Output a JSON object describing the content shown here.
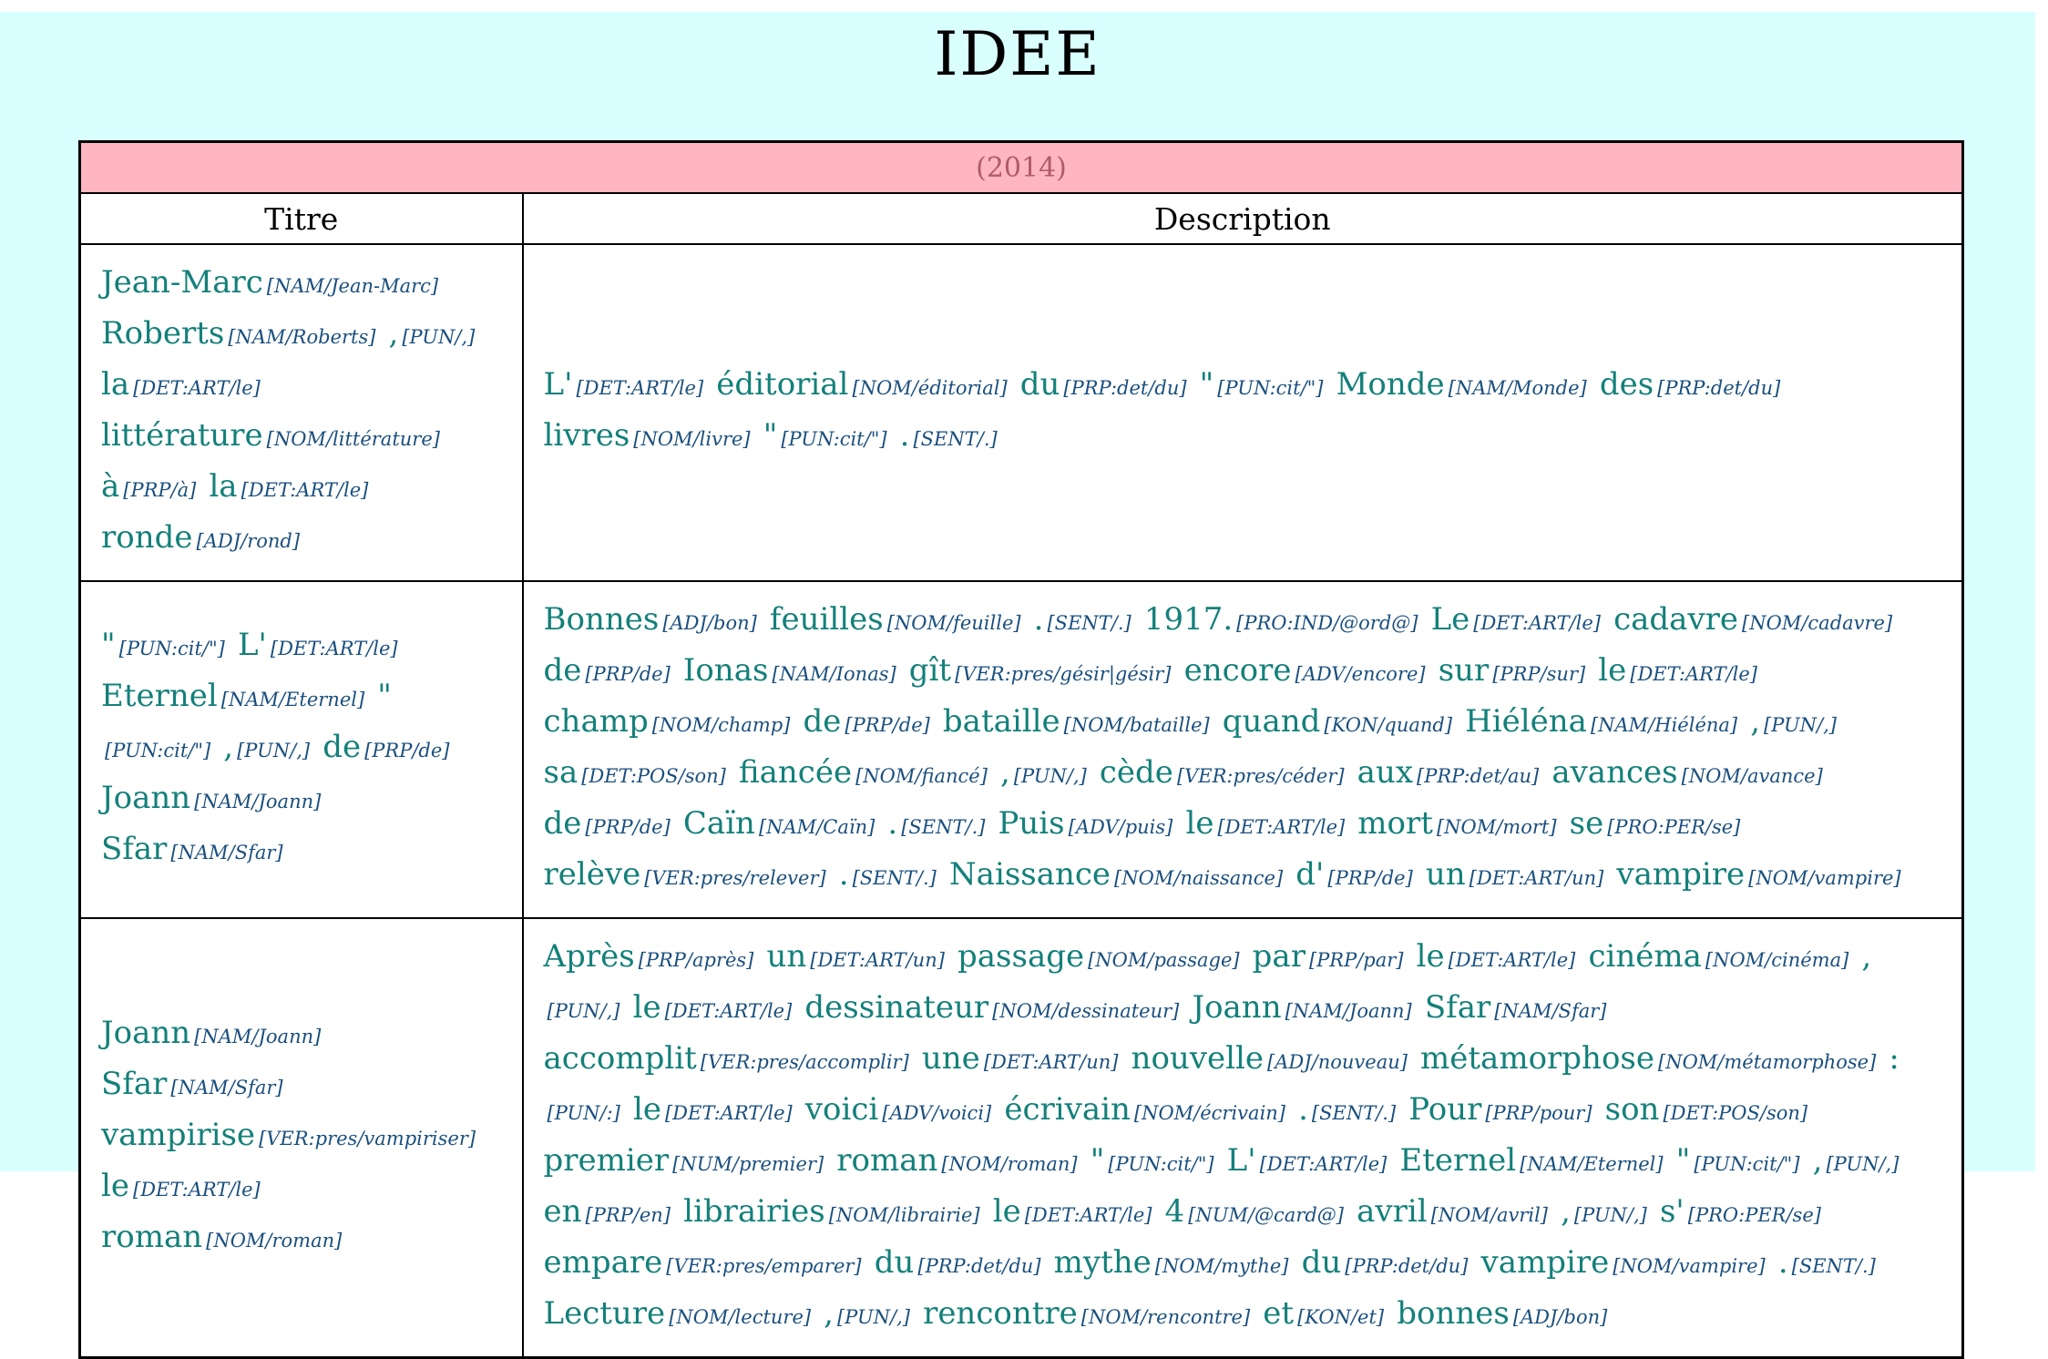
{
  "page": {
    "title": "IDEE"
  },
  "table": {
    "year": "(2014)",
    "headers": {
      "title": "Titre",
      "description": "Description"
    },
    "rows": [
      {
        "title": [
          {
            "w": "Jean-Marc",
            "t": "[NAM/Jean-Marc]"
          },
          {
            "w": "Roberts",
            "t": "[NAM/Roberts]"
          },
          {
            "w": ",",
            "t": "[PUN/,]"
          },
          {
            "w": "la",
            "t": "[DET:ART/le]"
          },
          {
            "w": "littérature",
            "t": "[NOM/littérature]"
          },
          {
            "w": "à",
            "t": "[PRP/à]"
          },
          {
            "w": "la",
            "t": "[DET:ART/le]"
          },
          {
            "w": "ronde",
            "t": "[ADJ/rond]"
          }
        ],
        "description": [
          {
            "w": "L'",
            "t": "[DET:ART/le]"
          },
          {
            "w": "éditorial",
            "t": "[NOM/éditorial]"
          },
          {
            "w": "du",
            "t": "[PRP:det/du]"
          },
          {
            "w": "\"",
            "t": "[PUN:cit/\"]"
          },
          {
            "w": "Monde",
            "t": "[NAM/Monde]"
          },
          {
            "w": "des",
            "t": "[PRP:det/du]"
          },
          {
            "w": "livres",
            "t": "[NOM/livre]"
          },
          {
            "w": "\"",
            "t": "[PUN:cit/\"]"
          },
          {
            "w": ".",
            "t": "[SENT/.]"
          }
        ]
      },
      {
        "title": [
          {
            "w": "\"",
            "t": "[PUN:cit/\"]"
          },
          {
            "w": "L'",
            "t": "[DET:ART/le]"
          },
          {
            "w": "Eternel",
            "t": "[NAM/Eternel]"
          },
          {
            "w": "\"",
            "t": "[PUN:cit/\"]"
          },
          {
            "w": ",",
            "t": "[PUN/,]"
          },
          {
            "w": "de",
            "t": "[PRP/de]"
          },
          {
            "w": "Joann",
            "t": "[NAM/Joann]"
          },
          {
            "w": "Sfar",
            "t": "[NAM/Sfar]"
          }
        ],
        "description": [
          {
            "w": "Bonnes",
            "t": "[ADJ/bon]"
          },
          {
            "w": "feuilles",
            "t": "[NOM/feuille]"
          },
          {
            "w": ".",
            "t": "[SENT/.]"
          },
          {
            "w": "1917.",
            "t": "[PRO:IND/@ord@]"
          },
          {
            "w": "Le",
            "t": "[DET:ART/le]"
          },
          {
            "w": "cadavre",
            "t": "[NOM/cadavre]"
          },
          {
            "w": "de",
            "t": "[PRP/de]"
          },
          {
            "w": "Ionas",
            "t": "[NAM/Ionas]"
          },
          {
            "w": "gît",
            "t": "[VER:pres/gésir|gésir]"
          },
          {
            "w": "encore",
            "t": "[ADV/encore]"
          },
          {
            "w": "sur",
            "t": "[PRP/sur]"
          },
          {
            "w": "le",
            "t": "[DET:ART/le]"
          },
          {
            "w": "champ",
            "t": "[NOM/champ]"
          },
          {
            "w": "de",
            "t": "[PRP/de]"
          },
          {
            "w": "bataille",
            "t": "[NOM/bataille]"
          },
          {
            "w": "quand",
            "t": "[KON/quand]"
          },
          {
            "w": "Hiéléna",
            "t": "[NAM/Hiéléna]"
          },
          {
            "w": ",",
            "t": "[PUN/,]"
          },
          {
            "w": "sa",
            "t": "[DET:POS/son]"
          },
          {
            "w": "fiancée",
            "t": "[NOM/fiancé]"
          },
          {
            "w": ",",
            "t": "[PUN/,]"
          },
          {
            "w": "cède",
            "t": "[VER:pres/céder]"
          },
          {
            "w": "aux",
            "t": "[PRP:det/au]"
          },
          {
            "w": "avances",
            "t": "[NOM/avance]"
          },
          {
            "w": "de",
            "t": "[PRP/de]"
          },
          {
            "w": "Caïn",
            "t": "[NAM/Caïn]"
          },
          {
            "w": ".",
            "t": "[SENT/.]"
          },
          {
            "w": "Puis",
            "t": "[ADV/puis]"
          },
          {
            "w": "le",
            "t": "[DET:ART/le]"
          },
          {
            "w": "mort",
            "t": "[NOM/mort]"
          },
          {
            "w": "se",
            "t": "[PRO:PER/se]"
          },
          {
            "w": "relève",
            "t": "[VER:pres/relever]"
          },
          {
            "w": ".",
            "t": "[SENT/.]"
          },
          {
            "w": "Naissance",
            "t": "[NOM/naissance]"
          },
          {
            "w": "d'",
            "t": "[PRP/de]"
          },
          {
            "w": "un",
            "t": "[DET:ART/un]"
          },
          {
            "w": "vampire",
            "t": "[NOM/vampire]"
          }
        ]
      },
      {
        "title": [
          {
            "w": "Joann",
            "t": "[NAM/Joann]"
          },
          {
            "w": "Sfar",
            "t": "[NAM/Sfar]"
          },
          {
            "w": "vampirise",
            "t": "[VER:pres/vampiriser]"
          },
          {
            "w": "le",
            "t": "[DET:ART/le]"
          },
          {
            "w": "roman",
            "t": "[NOM/roman]"
          }
        ],
        "description": [
          {
            "w": "Après",
            "t": "[PRP/après]"
          },
          {
            "w": "un",
            "t": "[DET:ART/un]"
          },
          {
            "w": "passage",
            "t": "[NOM/passage]"
          },
          {
            "w": "par",
            "t": "[PRP/par]"
          },
          {
            "w": "le",
            "t": "[DET:ART/le]"
          },
          {
            "w": "cinéma",
            "t": "[NOM/cinéma]"
          },
          {
            "w": ",",
            "t": "[PUN/,]"
          },
          {
            "w": "le",
            "t": "[DET:ART/le]"
          },
          {
            "w": "dessinateur",
            "t": "[NOM/dessinateur]"
          },
          {
            "w": "Joann",
            "t": "[NAM/Joann]"
          },
          {
            "w": "Sfar",
            "t": "[NAM/Sfar]"
          },
          {
            "w": "accomplit",
            "t": "[VER:pres/accomplir]"
          },
          {
            "w": "une",
            "t": "[DET:ART/un]"
          },
          {
            "w": "nouvelle",
            "t": "[ADJ/nouveau]"
          },
          {
            "w": "métamorphose",
            "t": "[NOM/métamorphose]"
          },
          {
            "w": ":",
            "t": "[PUN/:]"
          },
          {
            "w": "le",
            "t": "[DET:ART/le]"
          },
          {
            "w": "voici",
            "t": "[ADV/voici]"
          },
          {
            "w": "écrivain",
            "t": "[NOM/écrivain]"
          },
          {
            "w": ".",
            "t": "[SENT/.]"
          },
          {
            "w": "Pour",
            "t": "[PRP/pour]"
          },
          {
            "w": "son",
            "t": "[DET:POS/son]"
          },
          {
            "w": "premier",
            "t": "[NUM/premier]"
          },
          {
            "w": "roman",
            "t": "[NOM/roman]"
          },
          {
            "w": "\"",
            "t": "[PUN:cit/\"]"
          },
          {
            "w": "L'",
            "t": "[DET:ART/le]"
          },
          {
            "w": "Eternel",
            "t": "[NAM/Eternel]"
          },
          {
            "w": "\"",
            "t": "[PUN:cit/\"]"
          },
          {
            "w": ",",
            "t": "[PUN/,]"
          },
          {
            "w": "en",
            "t": "[PRP/en]"
          },
          {
            "w": "librairies",
            "t": "[NOM/librairie]"
          },
          {
            "w": "le",
            "t": "[DET:ART/le]"
          },
          {
            "w": "4",
            "t": "[NUM/@card@]"
          },
          {
            "w": "avril",
            "t": "[NOM/avril]"
          },
          {
            "w": ",",
            "t": "[PUN/,]"
          },
          {
            "w": "s'",
            "t": "[PRO:PER/se]"
          },
          {
            "w": "empare",
            "t": "[VER:pres/emparer]"
          },
          {
            "w": "du",
            "t": "[PRP:det/du]"
          },
          {
            "w": "mythe",
            "t": "[NOM/mythe]"
          },
          {
            "w": "du",
            "t": "[PRP:det/du]"
          },
          {
            "w": "vampire",
            "t": "[NOM/vampire]"
          },
          {
            "w": ".",
            "t": "[SENT/.]"
          },
          {
            "w": "Lecture",
            "t": "[NOM/lecture]"
          },
          {
            "w": ",",
            "t": "[PUN/,]"
          },
          {
            "w": "rencontre",
            "t": "[NOM/rencontre]"
          },
          {
            "w": "et",
            "t": "[KON/et]"
          },
          {
            "w": "bonnes",
            "t": "[ADJ/bon]"
          }
        ]
      }
    ]
  }
}
